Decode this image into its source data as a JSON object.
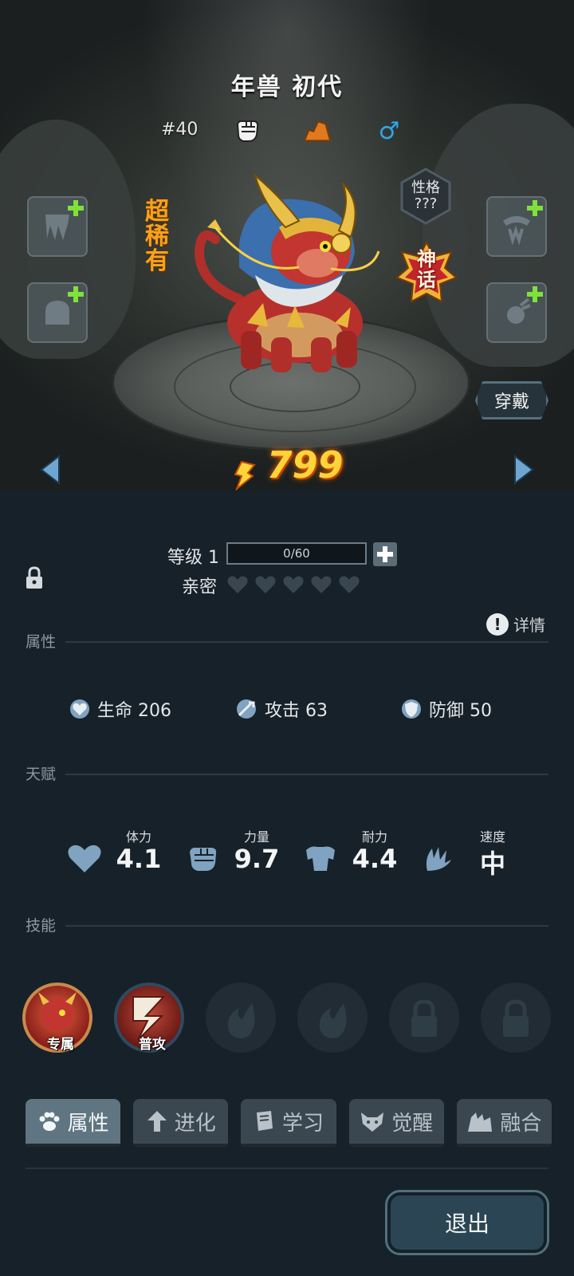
{
  "pet": {
    "name": "年兽 初代",
    "number": "#40",
    "rarity": "超稀有",
    "nature": "性格\n???",
    "nature_line1": "性格",
    "nature_line2": "???",
    "tier": "神话",
    "tier_line1": "神",
    "tier_line2": "话",
    "power": "799",
    "gender_symbol": "♂"
  },
  "equip": {
    "wear_label": "穿戴"
  },
  "level": {
    "label": "等级 1",
    "progress_text": "0/60",
    "progress": 0
  },
  "intimacy": {
    "label": "亲密",
    "hearts_filled": 0,
    "hearts_total": 5
  },
  "detail": {
    "icon": "!",
    "label": "详情"
  },
  "sections": {
    "attributes": "属性",
    "talent": "天赋",
    "skills": "技能"
  },
  "stats": [
    {
      "icon": "heart-shield-icon",
      "label": "生命",
      "value": "206"
    },
    {
      "icon": "sword-icon",
      "label": "攻击",
      "value": "63"
    },
    {
      "icon": "shield-icon",
      "label": "防御",
      "value": "50"
    }
  ],
  "stat_text": {
    "hp": "生命 206",
    "atk": "攻击 63",
    "def": "防御 50"
  },
  "talents": {
    "stamina": {
      "label": "体力",
      "value": "4.1"
    },
    "strength": {
      "label": "力量",
      "value": "9.7"
    },
    "endurance": {
      "label": "耐力",
      "value": "4.4"
    },
    "speed": {
      "label": "速度",
      "value": "中"
    }
  },
  "skills": {
    "exclusive_label": "专属",
    "normal_label": "普攻"
  },
  "tabs": {
    "attributes": "属性",
    "evolve": "进化",
    "learn": "学习",
    "awaken": "觉醒",
    "fusion": "融合"
  },
  "exit_label": "退出",
  "colors": {
    "panel_bg": "#172129",
    "power_gold": "#ffd43a",
    "rarity_orange": "#f8a21a",
    "gender_blue": "#2ea7e8",
    "plus_green": "#7ee23a"
  }
}
